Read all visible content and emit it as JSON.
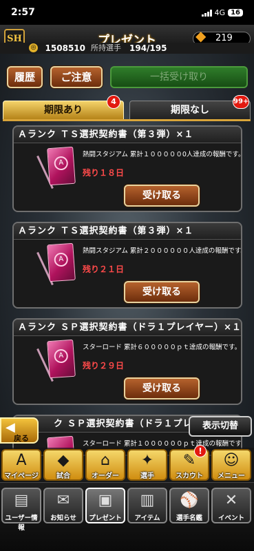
{
  "status": {
    "time": "2:57",
    "network": "4G",
    "battery": "16"
  },
  "header": {
    "title": "プレゼント",
    "coins": "219",
    "points": "1508510",
    "owned_label": "所持選手",
    "owned": "194/195"
  },
  "actions": {
    "history": "履歴",
    "notice": "ご注意",
    "receive_all": "一括受け取り"
  },
  "tabs": [
    {
      "label": "期限あり",
      "badge": "4",
      "active": true
    },
    {
      "label": "期限なし",
      "badge": "99+",
      "active": false
    }
  ],
  "cards": [
    {
      "title": "Ａランク ＴＳ選択契約書（第３弾）×１",
      "desc": "熱闘スタジアム 累計１０００００0人達成の報酬です。",
      "remain": "残り１８日",
      "button": "受け取る"
    },
    {
      "title": "Ａランク ＴＳ選択契約書（第３弾）×１",
      "desc": "熱闘スタジアム 累計２００００００人達成の報酬です。",
      "remain": "残り２１日",
      "button": "受け取る"
    },
    {
      "title": "Ａランク ＳＰ選択契約書（ドラ１プレイヤー）×１",
      "desc": "スターロード 累計６０００００ｐｔ達成の報酬です。",
      "remain": "残り２９日",
      "button": "受け取る"
    },
    {
      "title": "ク ＳＰ選択契約書（ドラ１プレイ",
      "desc": "スターロード 累計１００００００ｐｔ達成の報酬です。",
      "remain": "",
      "button": ""
    }
  ],
  "overlay": {
    "back": "戻る",
    "toggle": "表示切替"
  },
  "nav_main": [
    {
      "label": "マイページ",
      "icon": "A"
    },
    {
      "label": "試合",
      "icon": "◆"
    },
    {
      "label": "オーダー",
      "icon": "⌂"
    },
    {
      "label": "選手",
      "icon": "✦"
    },
    {
      "label": "スカウト",
      "icon": "✎",
      "alert": "!"
    },
    {
      "label": "メニュー",
      "icon": "☺"
    }
  ],
  "nav_sub": [
    {
      "label": "ユーザー情報",
      "icon": "▤"
    },
    {
      "label": "お知らせ",
      "icon": "✉"
    },
    {
      "label": "プレゼント",
      "icon": "▣",
      "active": true
    },
    {
      "label": "アイテム",
      "icon": "▥"
    },
    {
      "label": "選手名鑑",
      "icon": "⚾"
    },
    {
      "label": "イベント",
      "icon": "✕"
    }
  ],
  "colors": {
    "accent": "#d9a53a",
    "remain": "#ff4a4a",
    "receive_all": "#2f7d2a"
  }
}
